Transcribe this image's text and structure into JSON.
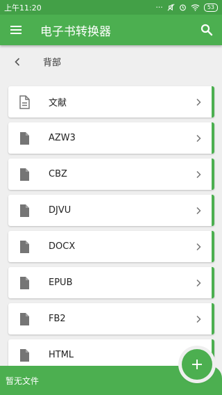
{
  "status_bar": {
    "time": "上午11:20",
    "battery": "53"
  },
  "app_bar": {
    "title": "电子书转换器"
  },
  "breadcrumb": {
    "label": "背部"
  },
  "items": [
    {
      "label": "文献",
      "icon": "document-outline-icon"
    },
    {
      "label": "AZW3",
      "icon": "file-icon"
    },
    {
      "label": "CBZ",
      "icon": "file-icon"
    },
    {
      "label": "DJVU",
      "icon": "file-icon"
    },
    {
      "label": "DOCX",
      "icon": "file-icon"
    },
    {
      "label": "EPUB",
      "icon": "file-icon"
    },
    {
      "label": "FB2",
      "icon": "file-icon"
    },
    {
      "label": "HTML",
      "icon": "file-icon"
    }
  ],
  "bottom_bar": {
    "text": "暂无文件"
  },
  "colors": {
    "primary": "#4caf50",
    "status_bar": "#43a047",
    "background": "#efefef",
    "icon_gray": "#757575"
  }
}
